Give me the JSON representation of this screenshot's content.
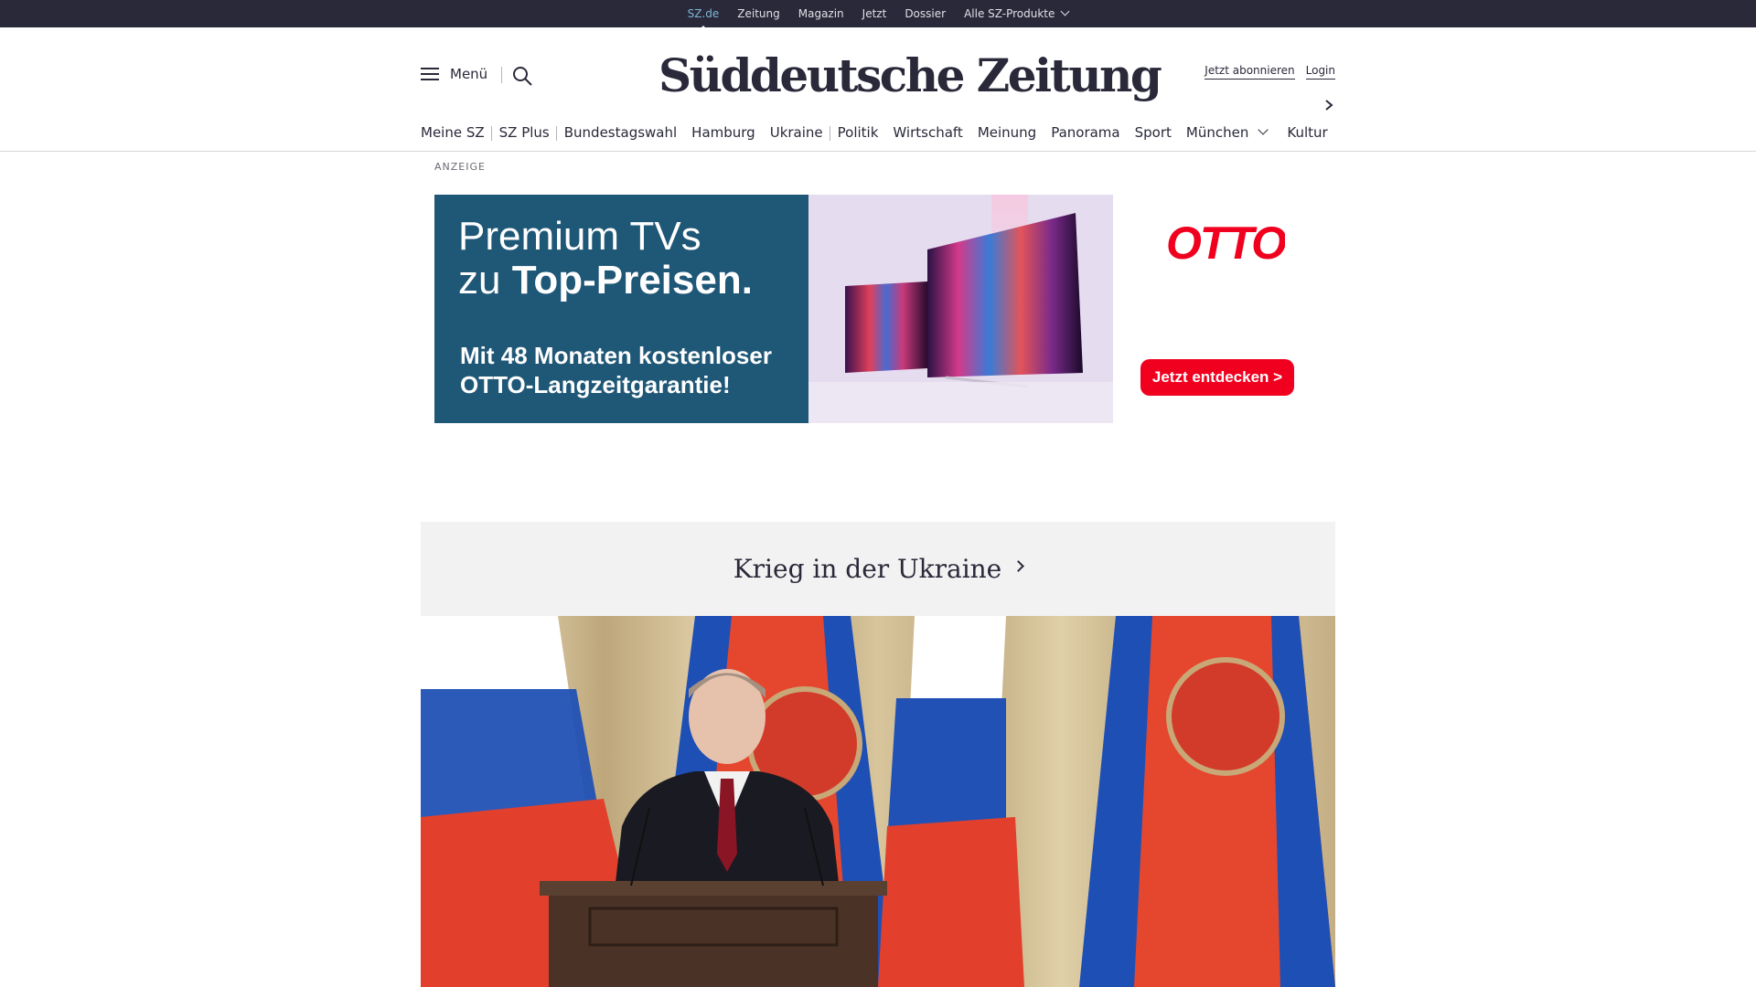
{
  "topbar": {
    "links": [
      {
        "label": "SZ.de"
      },
      {
        "label": "Zeitung"
      },
      {
        "label": "Magazin"
      },
      {
        "label": "Jetzt"
      },
      {
        "label": "Dossier"
      },
      {
        "label": "Alle SZ-Produkte"
      }
    ]
  },
  "header": {
    "menu_label": "Menü",
    "logo_text": "Süddeutsche Zeitung",
    "subscribe_label": "Jetzt abonnieren",
    "login_label": "Login"
  },
  "nav": {
    "items": [
      {
        "label": "Meine SZ"
      },
      {
        "label": "SZ Plus"
      },
      {
        "label": "Bundestagswahl"
      },
      {
        "label": "Hamburg"
      },
      {
        "label": "Ukraine"
      },
      {
        "label": "Politik"
      },
      {
        "label": "Wirtschaft"
      },
      {
        "label": "Meinung"
      },
      {
        "label": "Panorama"
      },
      {
        "label": "Sport"
      },
      {
        "label": "München"
      },
      {
        "label": "Kultur"
      }
    ]
  },
  "ad": {
    "label": "ANZEIGE",
    "headline_line1": "Premium TVs",
    "headline_line2_prefix": "zu ",
    "headline_line2_bold": "Top-Preisen.",
    "subline": "Mit 48 Monaten kostenloser OTTO-Langzeitgarantie!",
    "brand": "OTTO",
    "cta_label": "Jetzt entdecken >"
  },
  "dossier": {
    "title": "Krieg in der Ukraine"
  },
  "colors": {
    "topbar_bg": "#29293a",
    "active_link": "#7fb6d8",
    "ad_blue": "#1f5777",
    "otto_red": "#f0001e",
    "dossier_bg": "#f2f2f2"
  }
}
